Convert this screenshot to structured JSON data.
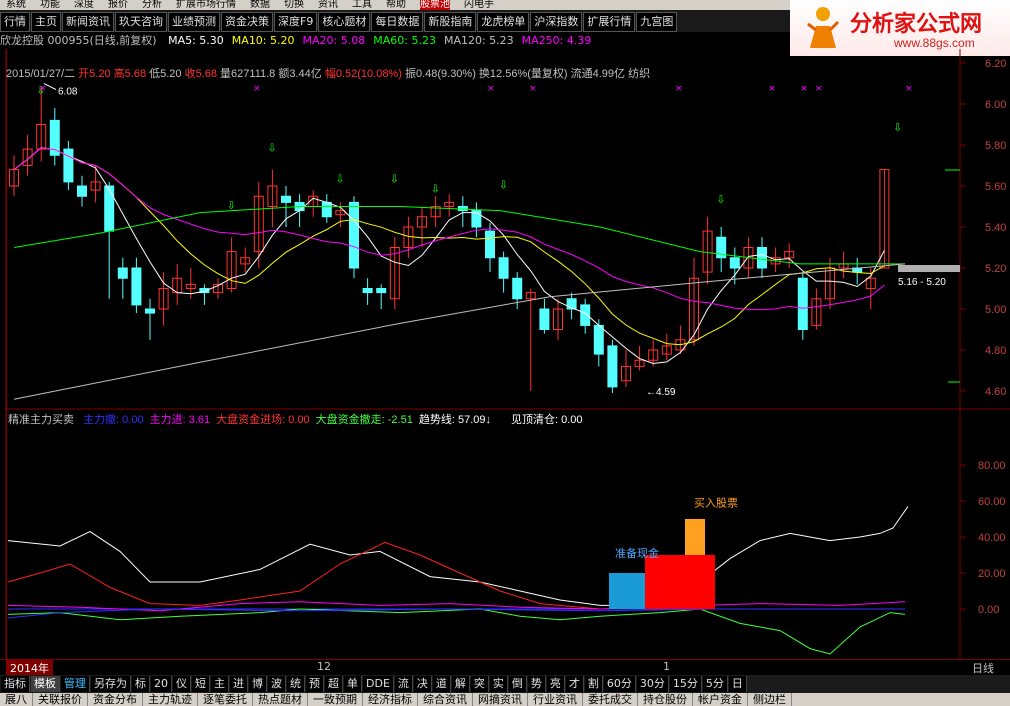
{
  "menubar": [
    "系统",
    "功能",
    "深度",
    "报价",
    "分析",
    "扩展市场行情",
    "数据",
    "切换",
    "资讯",
    "工具",
    "帮助",
    "股票池",
    "闪电手"
  ],
  "toolbar": [
    "行情",
    "主页",
    "新闻资讯",
    "玖天咨询",
    "业绩预测",
    "资金决策",
    "深度F9",
    "核心题材",
    "每日数据",
    "新股指南",
    "龙虎榜单",
    "沪深指数",
    "扩展行情",
    "九宫图"
  ],
  "logo": {
    "title": "分析家公式网",
    "url": "www.88gs.com"
  },
  "stock": {
    "name": "欣龙控股 000955(日线,前复权)",
    "ma": [
      {
        "label": "MA5: 5.30",
        "color": "#ffffff"
      },
      {
        "label": "MA10: 5.20",
        "color": "#ffff00"
      },
      {
        "label": "MA20: 5.08",
        "color": "#ff00ff"
      },
      {
        "label": "MA60: 5.23",
        "color": "#00ff00"
      },
      {
        "label": "MA120: 5.23",
        "color": "#c0c0c0"
      },
      {
        "label": "MA250: 4.39",
        "color": "#ff00ff"
      }
    ],
    "quote": "2015/01/27/二",
    "open": "开5.20",
    "high": "高5.68",
    "low": "低5.20",
    "close": "收5.68",
    "vol": "量627111.8",
    "amt": "额3.44亿",
    "chg": "幅0.52(10.08%)",
    "amp": "振0.48(9.30%)",
    "turnover": "换12.56%(量复权)",
    "float": "流通4.99亿",
    "industry": "纺织"
  },
  "price_axis": [
    "6.20",
    "6.00",
    "5.80",
    "5.60",
    "5.40",
    "5.20",
    "5.00",
    "4.80",
    "4.60"
  ],
  "price_marks": {
    "high": "6.08",
    "low": "4.59",
    "range": "5.16 - 5.20"
  },
  "indicator": {
    "name": "精准主力买卖",
    "items": [
      {
        "label": "主力撤: 0.00",
        "color": "#3030ff"
      },
      {
        "label": "主力进: 3.61",
        "color": "#ff00ff"
      },
      {
        "label": "大盘资金进场: 0.00",
        "color": "#ff3030"
      },
      {
        "label": "大盘资金撤走: -2.51",
        "color": "#40ff40"
      },
      {
        "label": "趋势线: 57.09",
        "color": "#ffffff"
      },
      {
        "label": "见顶清仓: 0.00",
        "color": "#ffffff"
      }
    ],
    "axis": [
      "80.00",
      "60.00",
      "40.00",
      "20.00",
      "0.00"
    ],
    "annot_buy": "买入股票",
    "annot_prep": "准备现金"
  },
  "xaxis": {
    "year": "2014年",
    "m1": "12",
    "m2": "1",
    "right": "日线"
  },
  "bottom_tabs": [
    "指标",
    "模板",
    "管理",
    "另存为",
    "标",
    "20",
    "仪",
    "短",
    "主",
    "进",
    "博",
    "波",
    "统",
    "预",
    "超",
    "单",
    "DDE",
    "流",
    "决",
    "道",
    "解",
    "突",
    "实",
    "倒",
    "势",
    "亮",
    "才",
    "割",
    "60分",
    "30分",
    "15分",
    "5分",
    "日"
  ],
  "bottom_info": [
    "展八",
    "关联报价",
    "资金分布",
    "主力轨迹",
    "逐笔委托",
    "热点题材",
    "一致预期",
    "经济指标",
    "综合资讯",
    "网摘资讯",
    "行业资讯",
    "委托成交",
    "持仓股份",
    "帐户资金",
    "侧边栏"
  ],
  "colors": {
    "up": "#ff3232",
    "down": "#54ffff",
    "ma5": "#ffffff",
    "ma10": "#ffff00",
    "ma20": "#ff00ff",
    "ma60": "#00ff00",
    "ma120": "#c0c0c0"
  }
}
